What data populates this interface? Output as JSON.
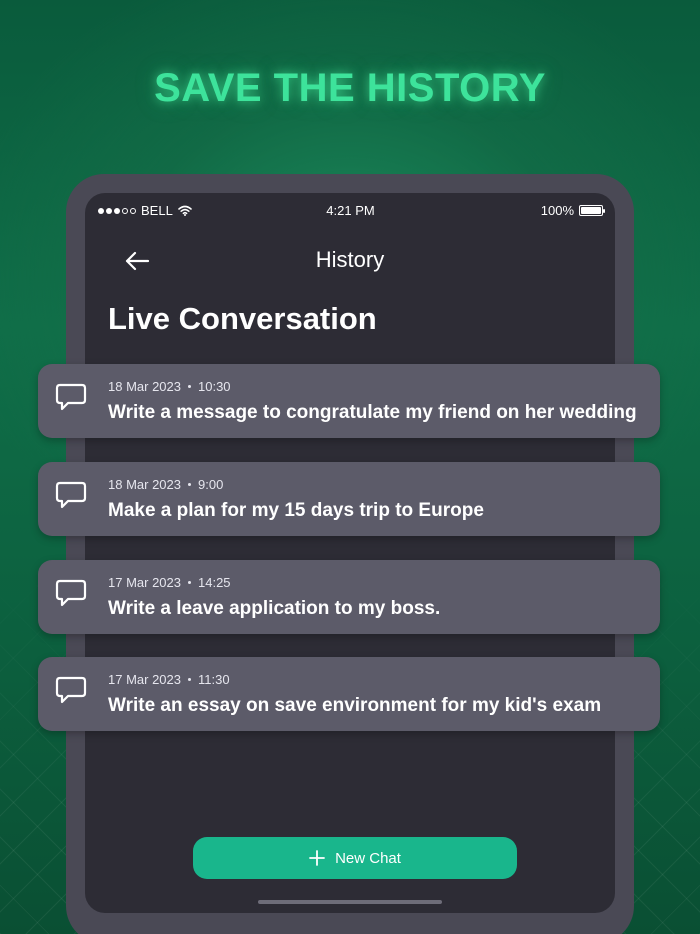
{
  "headline": "SAVE THE HISTORY",
  "status_bar": {
    "carrier": "BELL",
    "time": "4:21 PM",
    "battery": "100%",
    "battery_level": 1.0,
    "signal_bars_filled": 3,
    "signal_bars_total": 5
  },
  "nav": {
    "back_icon": "arrow-left-icon",
    "title": "History"
  },
  "section_title": "Live Conversation",
  "conversations": [
    {
      "date": "18 Mar 2023",
      "time": "10:30",
      "title": "Write a message to congratulate my friend on her wedding",
      "icon": "chat-bubble-icon"
    },
    {
      "date": "18 Mar 2023",
      "time": "9:00",
      "title": "Make a plan for my 15 days trip to Europe",
      "icon": "chat-bubble-icon"
    },
    {
      "date": "17 Mar 2023",
      "time": "14:25",
      "title": "Write a leave application to my boss.",
      "icon": "chat-bubble-icon"
    },
    {
      "date": "17 Mar 2023",
      "time": "11:30",
      "title": "Write an essay on save environment for my kid's exam",
      "icon": "chat-bubble-icon"
    }
  ],
  "new_chat": {
    "label": "New Chat",
    "icon": "plus-icon"
  },
  "colors": {
    "headline": "#3de39b",
    "accent": "#19b68c",
    "card": "#5c5b69",
    "screen": "#2d2c35",
    "device": "#4a4955"
  }
}
